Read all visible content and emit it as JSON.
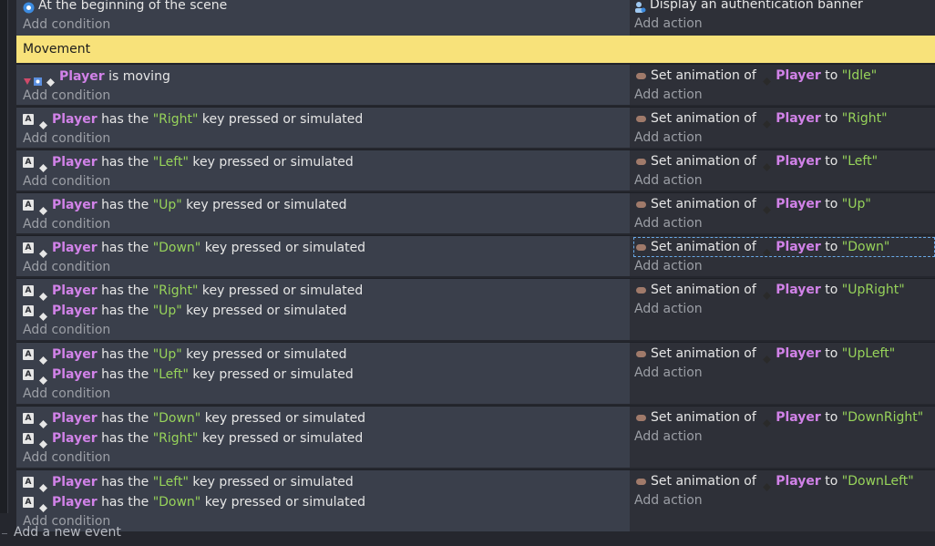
{
  "scene_event": {
    "condition": "At the beginning of the scene",
    "action": "Display an authentication banner",
    "add_condition": "Add condition",
    "add_action": "Add action"
  },
  "group": {
    "title": "Movement"
  },
  "labels": {
    "add_condition": "Add condition",
    "add_action": "Add action",
    "object": "Player",
    "has_the": "has the",
    "key_pressed": "key pressed or simulated",
    "set_animation_of": "Set animation of",
    "to": "to",
    "is_moving": "is moving"
  },
  "events": [
    {
      "conditions": [
        {
          "type": "moving"
        }
      ],
      "animation": "\"Idle\""
    },
    {
      "conditions": [
        {
          "type": "key",
          "key": "\"Right\""
        }
      ],
      "animation": "\"Right\""
    },
    {
      "conditions": [
        {
          "type": "key",
          "key": "\"Left\""
        }
      ],
      "animation": "\"Left\""
    },
    {
      "conditions": [
        {
          "type": "key",
          "key": "\"Up\""
        }
      ],
      "animation": "\"Up\""
    },
    {
      "conditions": [
        {
          "type": "key",
          "key": "\"Down\""
        }
      ],
      "animation": "\"Down\"",
      "selected": true
    },
    {
      "conditions": [
        {
          "type": "key",
          "key": "\"Right\""
        },
        {
          "type": "key",
          "key": "\"Up\""
        }
      ],
      "animation": "\"UpRight\""
    },
    {
      "conditions": [
        {
          "type": "key",
          "key": "\"Up\""
        },
        {
          "type": "key",
          "key": "\"Left\""
        }
      ],
      "animation": "\"UpLeft\""
    },
    {
      "conditions": [
        {
          "type": "key",
          "key": "\"Down\""
        },
        {
          "type": "key",
          "key": "\"Right\""
        }
      ],
      "animation": "\"DownRight\""
    },
    {
      "conditions": [
        {
          "type": "key",
          "key": "\"Left\""
        },
        {
          "type": "key",
          "key": "\"Down\""
        }
      ],
      "animation": "\"DownLeft\""
    }
  ],
  "footer": {
    "add_event": "Add a new event"
  },
  "icons": {
    "key": "keyboard-key-icon",
    "object": "object-diamond-icon",
    "animation": "animation-icon",
    "scene_start": "scene-start-icon",
    "auth": "authentication-icon",
    "movement": "movement-behavior-icon"
  },
  "colors": {
    "object": "#d182e8",
    "string": "#97d35a",
    "group": "#f8e27a",
    "selection": "#69a9e6"
  }
}
